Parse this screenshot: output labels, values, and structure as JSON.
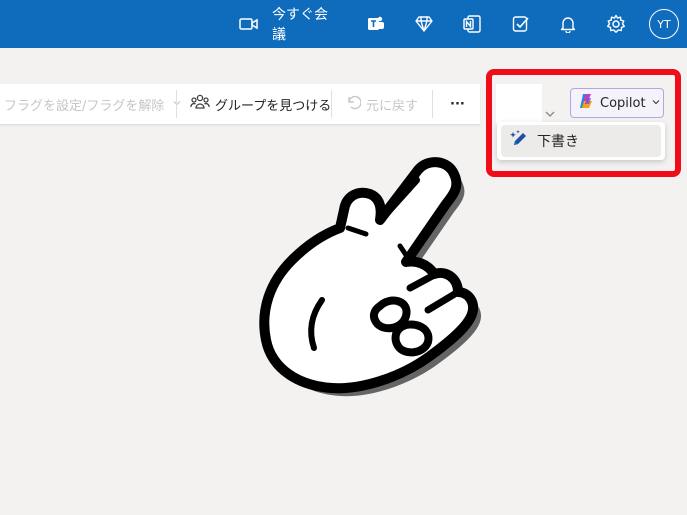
{
  "topbar": {
    "meet_now_label": "今すぐ会議",
    "avatar_initials": "YT",
    "icons": [
      "video-camera-icon",
      "teams-icon",
      "diamond-icon",
      "onenote-icon",
      "todo-icon",
      "bell-icon",
      "gear-icon"
    ]
  },
  "toolbar": {
    "flag_label": "フラグを設定/フラグを解除",
    "find_groups_label": "グループを見つける",
    "undo_label": "元に戻す",
    "more_label": "···"
  },
  "copilot": {
    "button_label": "Copilot",
    "menu_item_label": "下書き"
  },
  "colors": {
    "header_blue": "#0f6cbd",
    "highlight_red": "#ee0d18",
    "background": "#f3f2f1"
  }
}
